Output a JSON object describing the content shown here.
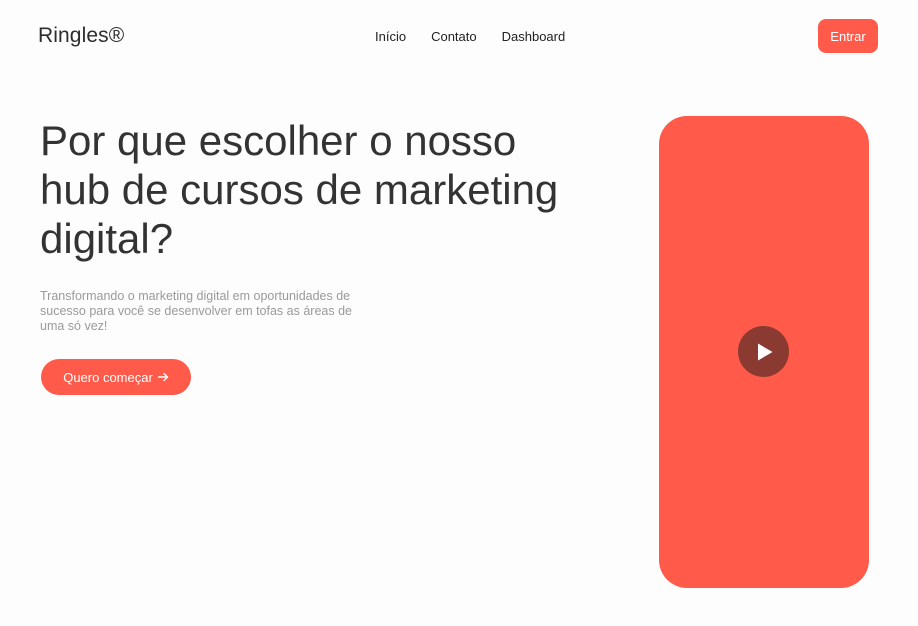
{
  "header": {
    "logo": "Ringles®",
    "nav": [
      {
        "label": "Início"
      },
      {
        "label": "Contato"
      },
      {
        "label": "Dashboard"
      }
    ],
    "login_label": "Entrar"
  },
  "hero": {
    "title": "Por que escolher o nosso hub de cursos de marketing digital?",
    "subtitle": "Transformando o marketing digital em oportunidades de sucesso para você se desenvolver em tofas as áreas de uma só vez!",
    "cta_label": "Quero começar",
    "cta_icon": "arrow-right-icon"
  },
  "video": {
    "icon": "play-icon"
  },
  "colors": {
    "accent": "#ff5a4a",
    "play_button": "#8a3a30",
    "text": "#333333",
    "muted": "#9a9a9a"
  }
}
